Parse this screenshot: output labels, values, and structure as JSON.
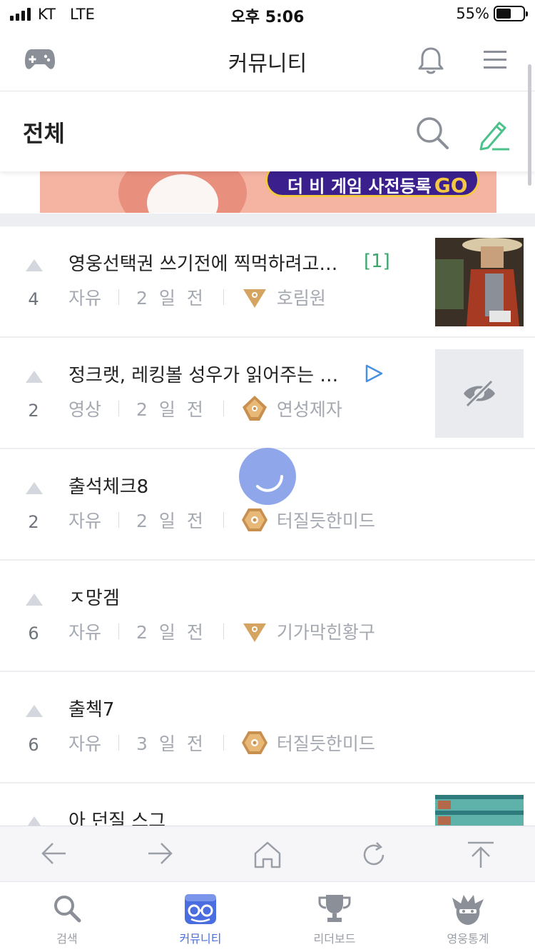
{
  "status_bar": {
    "carrier": "KT",
    "network": "LTE",
    "time": "오후 5:06",
    "battery": "55%",
    "battery_level": 0.55
  },
  "header": {
    "title": "커뮤니티",
    "left_icon": "gamepad-icon",
    "right_icons": [
      "bell-icon",
      "menu-icon"
    ]
  },
  "category": {
    "title": "전체",
    "icons": [
      "search-icon",
      "pencil-icon"
    ]
  },
  "banner": {
    "text": "더 비 게임 사전등록",
    "cta": "GO"
  },
  "posts": [
    {
      "votes": "4",
      "title": "영웅선택권 쓰기전에 찍먹하려고…",
      "comments": "[1]",
      "category": "자유",
      "date": "2 일 전",
      "tier": "bronze",
      "author": "호림원",
      "thumbnail": "hero-image"
    },
    {
      "votes": "2",
      "title": "정크랫, 레킹볼 성우가 읽어주는 …",
      "video": true,
      "category": "영상",
      "date": "2 일 전",
      "tier": "silver",
      "author": "연성제자",
      "thumbnail": "hidden"
    },
    {
      "votes": "2",
      "title": "출석체크8",
      "category": "자유",
      "date": "2 일 전",
      "tier": "gold",
      "author": "터질듯한미드"
    },
    {
      "votes": "6",
      "title": "ㅈ망겜",
      "category": "자유",
      "date": "2 일 전",
      "tier": "bronze",
      "author": "기가막힌황구"
    },
    {
      "votes": "6",
      "title": "출첵7",
      "category": "자유",
      "date": "3 일 전",
      "tier": "gold",
      "author": "터질듯한미드"
    },
    {
      "votes": "",
      "title": "아 던질 스그",
      "category": "",
      "date": "",
      "tier": "",
      "author": "",
      "thumbnail": "scoreboard"
    }
  ],
  "browser_toolbar": [
    "back-arrow-icon",
    "forward-arrow-icon",
    "home-icon",
    "refresh-icon",
    "scroll-top-icon"
  ],
  "tabs": [
    {
      "label": "검색",
      "icon": "search-icon",
      "active": false
    },
    {
      "label": "커뮤니티",
      "icon": "community-icon",
      "active": true
    },
    {
      "label": "리더보드",
      "icon": "trophy-icon",
      "active": false
    },
    {
      "label": "영웅통계",
      "icon": "hero-icon",
      "active": false
    }
  ],
  "colors": {
    "accent": "#4a6ee0",
    "comment": "#3aa76d",
    "pencil": "#4cc28b",
    "video": "#4a90e2",
    "tier_bronze": "#d6a461",
    "meta_text": "#a4a8b0"
  }
}
